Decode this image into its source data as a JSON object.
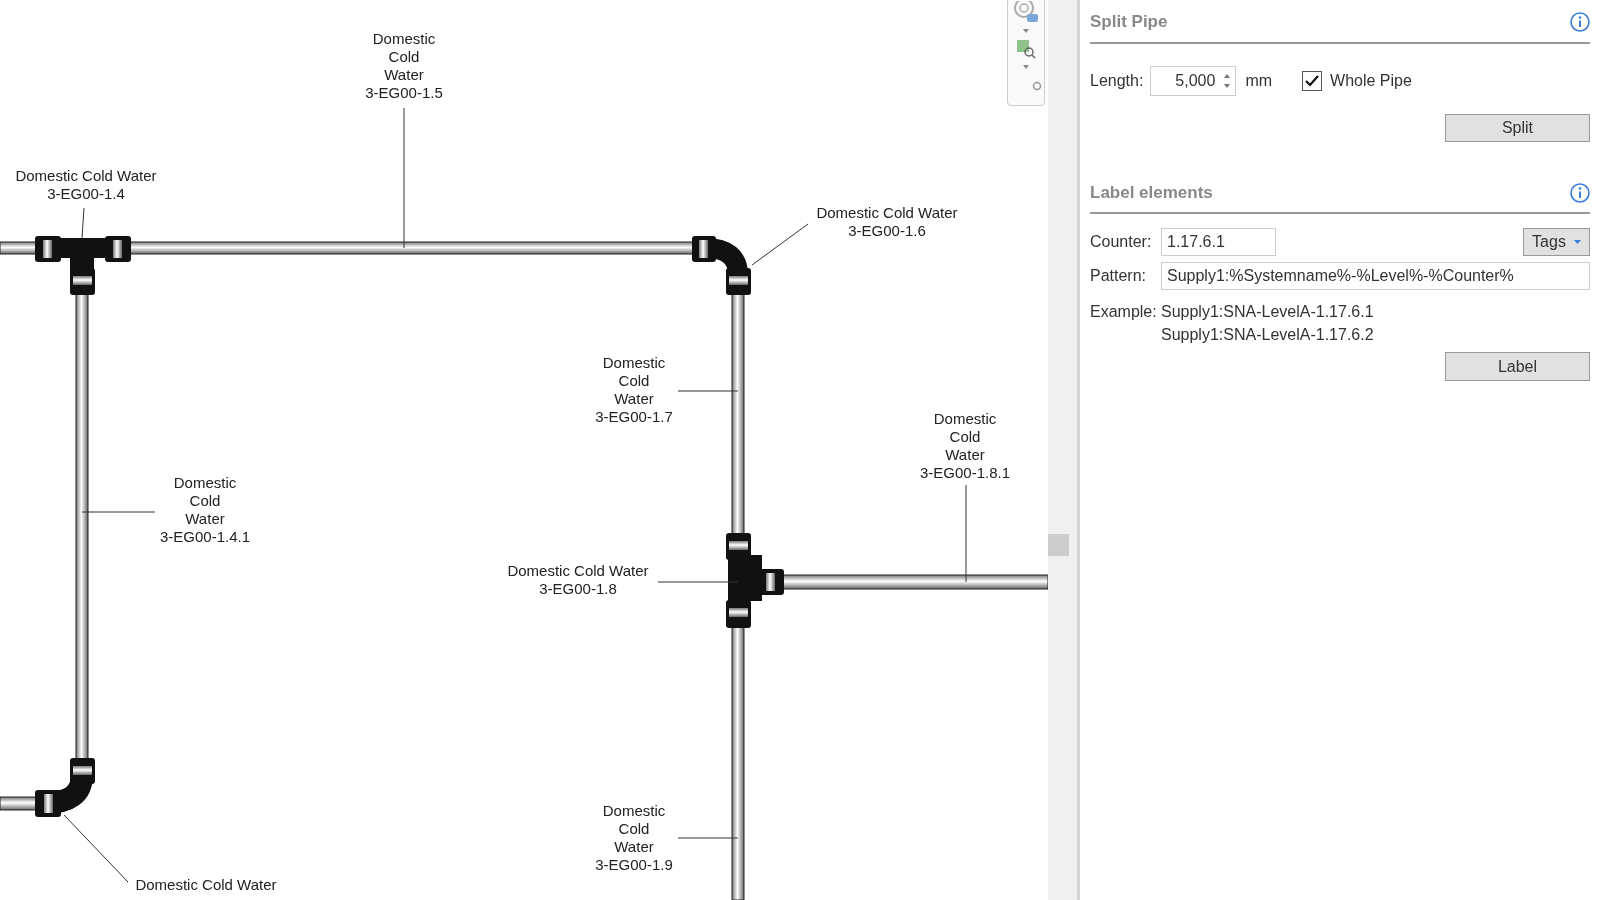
{
  "view_labels": [
    {
      "lines": [
        "Domestic Cold Water",
        "3-EG00-1.4"
      ]
    },
    {
      "lines": [
        "Domestic",
        "Cold",
        "Water",
        "3-EG00-1.5"
      ]
    },
    {
      "lines": [
        "Domestic Cold Water",
        "3-EG00-1.6"
      ]
    },
    {
      "lines": [
        "Domestic",
        "Cold",
        "Water",
        "3-EG00-1.7"
      ]
    },
    {
      "lines": [
        "Domestic",
        "Cold",
        "Water",
        "3-EG00-1.4.1"
      ]
    },
    {
      "lines": [
        "Domestic",
        "Cold",
        "Water",
        "3-EG00-1.8.1"
      ]
    },
    {
      "lines": [
        "Domestic Cold Water",
        "3-EG00-1.8"
      ]
    },
    {
      "lines": [
        "Domestic",
        "Cold",
        "Water",
        "3-EG00-1.9"
      ]
    },
    {
      "lines": [
        "Domestic Cold Water"
      ]
    }
  ],
  "split_pipe": {
    "title": "Split Pipe",
    "length_label": "Length:",
    "length_value": "5,000",
    "unit": "mm",
    "whole_pipe": {
      "label": "Whole Pipe",
      "checked": true
    },
    "button": "Split"
  },
  "label_elements": {
    "title": "Label elements",
    "counter_label": "Counter:",
    "counter_value": "1.17.6.1",
    "tags_button": "Tags",
    "pattern_label": "Pattern:",
    "pattern_value": "Supply1:%Systemname%-%Level%-%Counter%",
    "example_label": "Example:",
    "examples": [
      "Supply1:SNA-LevelA-1.17.6.1",
      "Supply1:SNA-LevelA-1.17.6.2"
    ],
    "button": "Label"
  }
}
